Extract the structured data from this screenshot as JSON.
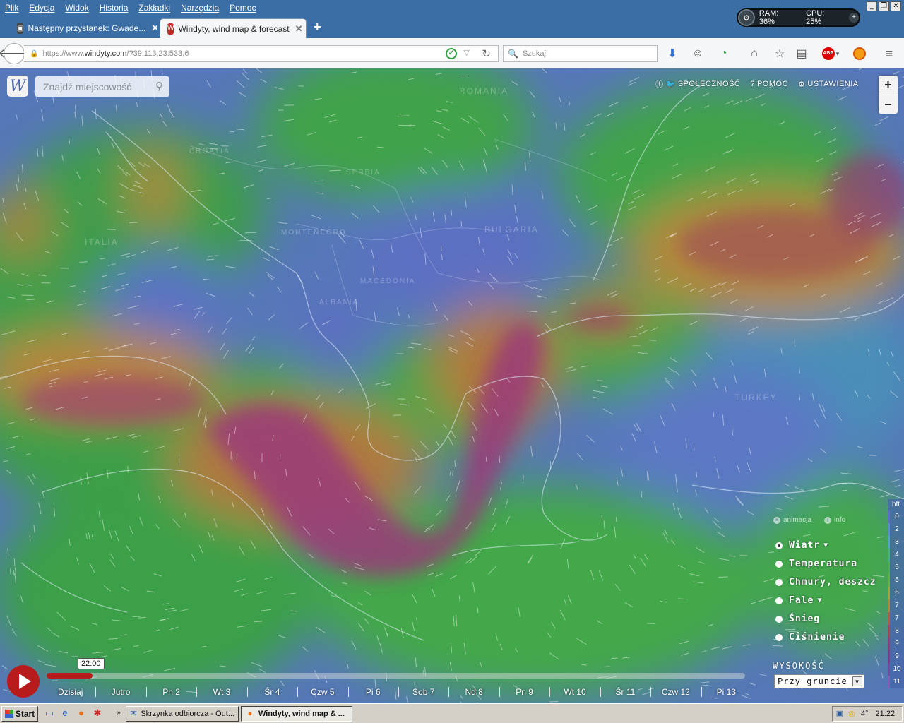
{
  "menubar": {
    "items": [
      "Plik",
      "Edycja",
      "Widok",
      "Historia",
      "Zakładki",
      "Narzędzia",
      "Pomoc"
    ]
  },
  "tabs": [
    {
      "title": "Następny przystanek: Gwade...",
      "active": false
    },
    {
      "title": "Windyty, wind map & forecast",
      "active": true
    }
  ],
  "system_monitor": {
    "ram": "RAM: 36%",
    "cpu": "CPU: 25%"
  },
  "navbar": {
    "url_prefix": "https://www.",
    "url_host": "windyty.com",
    "url_path": "/?39.113,23.533,6",
    "search_placeholder": "Szukaj"
  },
  "map": {
    "search_placeholder": "Znajdź miejscowość",
    "links": [
      "SPOŁECZNOŚĆ",
      "POMOC",
      "USTAWIENIA"
    ],
    "zoom_in": "+",
    "zoom_out": "−",
    "country_labels": [
      "ROMANIA",
      "CROATIA",
      "SERBIA",
      "MONTENEGRO",
      "BULGARIA",
      "MACEDONIA",
      "ALBANIA",
      "ITALIA",
      "TURKEY"
    ],
    "layer_toggles": {
      "animation": "animacja",
      "info": "info"
    },
    "layers": [
      {
        "label": "Wiatr",
        "selected": true,
        "has_menu": true
      },
      {
        "label": "Temperatura",
        "selected": false,
        "has_menu": false
      },
      {
        "label": "Chmury, deszcz",
        "selected": false,
        "has_menu": false
      },
      {
        "label": "Fale",
        "selected": false,
        "has_menu": true
      },
      {
        "label": "Śnieg",
        "selected": false,
        "has_menu": false
      },
      {
        "label": "Ciśnienie",
        "selected": false,
        "has_menu": false
      }
    ],
    "height_label": "WYSOKOŚĆ",
    "height_value": "Przy gruncie",
    "legend": {
      "unit": "bft",
      "steps": [
        {
          "value": "0",
          "color": "#5b6fc0"
        },
        {
          "value": "2",
          "color": "#5a8ad0"
        },
        {
          "value": "3",
          "color": "#4fa6b8"
        },
        {
          "value": "4",
          "color": "#46b07a"
        },
        {
          "value": "5",
          "color": "#4bb04a"
        },
        {
          "value": "5",
          "color": "#62b23e"
        },
        {
          "value": "6",
          "color": "#a4a23e"
        },
        {
          "value": "7",
          "color": "#b8823a"
        },
        {
          "value": "7",
          "color": "#b8583e"
        },
        {
          "value": "8",
          "color": "#a8405e"
        },
        {
          "value": "9",
          "color": "#9a3a7a"
        },
        {
          "value": "9",
          "color": "#8a3a8a"
        },
        {
          "value": "10",
          "color": "#7a4aa0"
        },
        {
          "value": "11",
          "color": "#8a5ab8"
        }
      ]
    },
    "timeline": {
      "current_time": "22:00",
      "progress": 0.066,
      "days": [
        "Dzisiaj",
        "Jutro",
        "Pn 2",
        "Wt 3",
        "Śr 4",
        "Czw 5",
        "Pi 6",
        "Sob 7",
        "Nd 8",
        "Pn 9",
        "Wt 10",
        "Śr 11",
        "Czw 12",
        "Pi 13"
      ]
    }
  },
  "taskbar": {
    "start": "Start",
    "tasks": [
      {
        "title": "Skrzynka odbiorcza - Out...",
        "active": false
      },
      {
        "title": "Windyty, wind map & ...",
        "active": true
      }
    ],
    "temperature": "4°",
    "clock": "21:22"
  }
}
